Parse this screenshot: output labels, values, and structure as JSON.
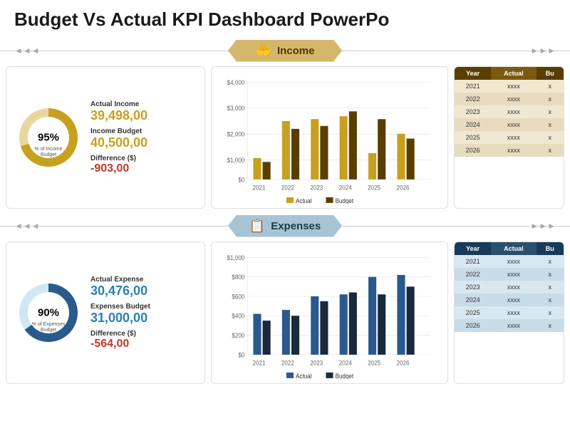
{
  "title": "Budget Vs Actual KPI Dashboard PowerPo",
  "income_section": {
    "label": "Income",
    "icon": "🤲",
    "kpi": {
      "percent": "95%",
      "percent_sublabel": "% of Income\nBudget",
      "actual_label": "Actual Income",
      "actual_value": "39,498,00",
      "budget_label": "Income Budget",
      "budget_value": "40,500,00",
      "diff_label": "Difference ($)",
      "diff_value": "-903,00"
    },
    "chart": {
      "y_labels": [
        "$4,000",
        "$3,000",
        "$2,000",
        "$1,000",
        "$0"
      ],
      "x_labels": [
        "2021",
        "2022",
        "2023",
        "2024",
        "2025",
        "2026"
      ],
      "actual_bars": [
        0.22,
        0.6,
        0.62,
        0.65,
        0.27,
        0.47
      ],
      "budget_bars": [
        0.18,
        0.52,
        0.55,
        0.7,
        0.62,
        0.42
      ],
      "actual_color": "#c8a020",
      "budget_color": "#5a3e00",
      "legend_actual": "Actual",
      "legend_budget": "Budget"
    },
    "table": {
      "col1": "Year",
      "col2": "Actual",
      "col3": "Bu",
      "rows": [
        {
          "year": "2021",
          "actual": "xxxx",
          "budget": "x"
        },
        {
          "year": "2022",
          "actual": "xxxx",
          "budget": "x"
        },
        {
          "year": "2023",
          "actual": "xxxx",
          "budget": "x"
        },
        {
          "year": "2024",
          "actual": "xxxx",
          "budget": "x"
        },
        {
          "year": "2025",
          "actual": "xxxx",
          "budget": "x"
        },
        {
          "year": "2026",
          "actual": "xxxx",
          "budget": "x"
        }
      ]
    }
  },
  "expenses_section": {
    "label": "Expenses",
    "icon": "📋",
    "kpi": {
      "percent": "90%",
      "percent_sublabel": "% of Expenses\nBudget",
      "actual_label": "Actual Expense",
      "actual_value": "30,476,00",
      "budget_label": "Expenses Budget",
      "budget_value": "31,000,00",
      "diff_label": "Difference ($)",
      "diff_value": "-564,00"
    },
    "chart": {
      "y_labels": [
        "$1,000",
        "$800",
        "$600",
        "$400",
        "$200",
        "$0"
      ],
      "x_labels": [
        "2021",
        "2022",
        "2023",
        "2024",
        "2025",
        "2026"
      ],
      "actual_bars": [
        0.42,
        0.46,
        0.6,
        0.62,
        0.8,
        0.82
      ],
      "budget_bars": [
        0.35,
        0.4,
        0.55,
        0.64,
        0.62,
        0.7
      ],
      "actual_color": "#2a5a8c",
      "budget_color": "#1a2a3c",
      "legend_actual": "Actual",
      "legend_budget": "Budget"
    },
    "table": {
      "col1": "Year",
      "col2": "Actual",
      "col3": "Bu",
      "rows": [
        {
          "year": "2021",
          "actual": "xxxx",
          "budget": "x"
        },
        {
          "year": "2022",
          "actual": "xxxx",
          "budget": "x"
        },
        {
          "year": "2023",
          "actual": "xxxx",
          "budget": "x"
        },
        {
          "year": "2024",
          "actual": "xxxx",
          "budget": "x"
        },
        {
          "year": "2025",
          "actual": "xxxx",
          "budget": "x"
        },
        {
          "year": "2026",
          "actual": "xxxx",
          "budget": "x"
        }
      ]
    }
  }
}
